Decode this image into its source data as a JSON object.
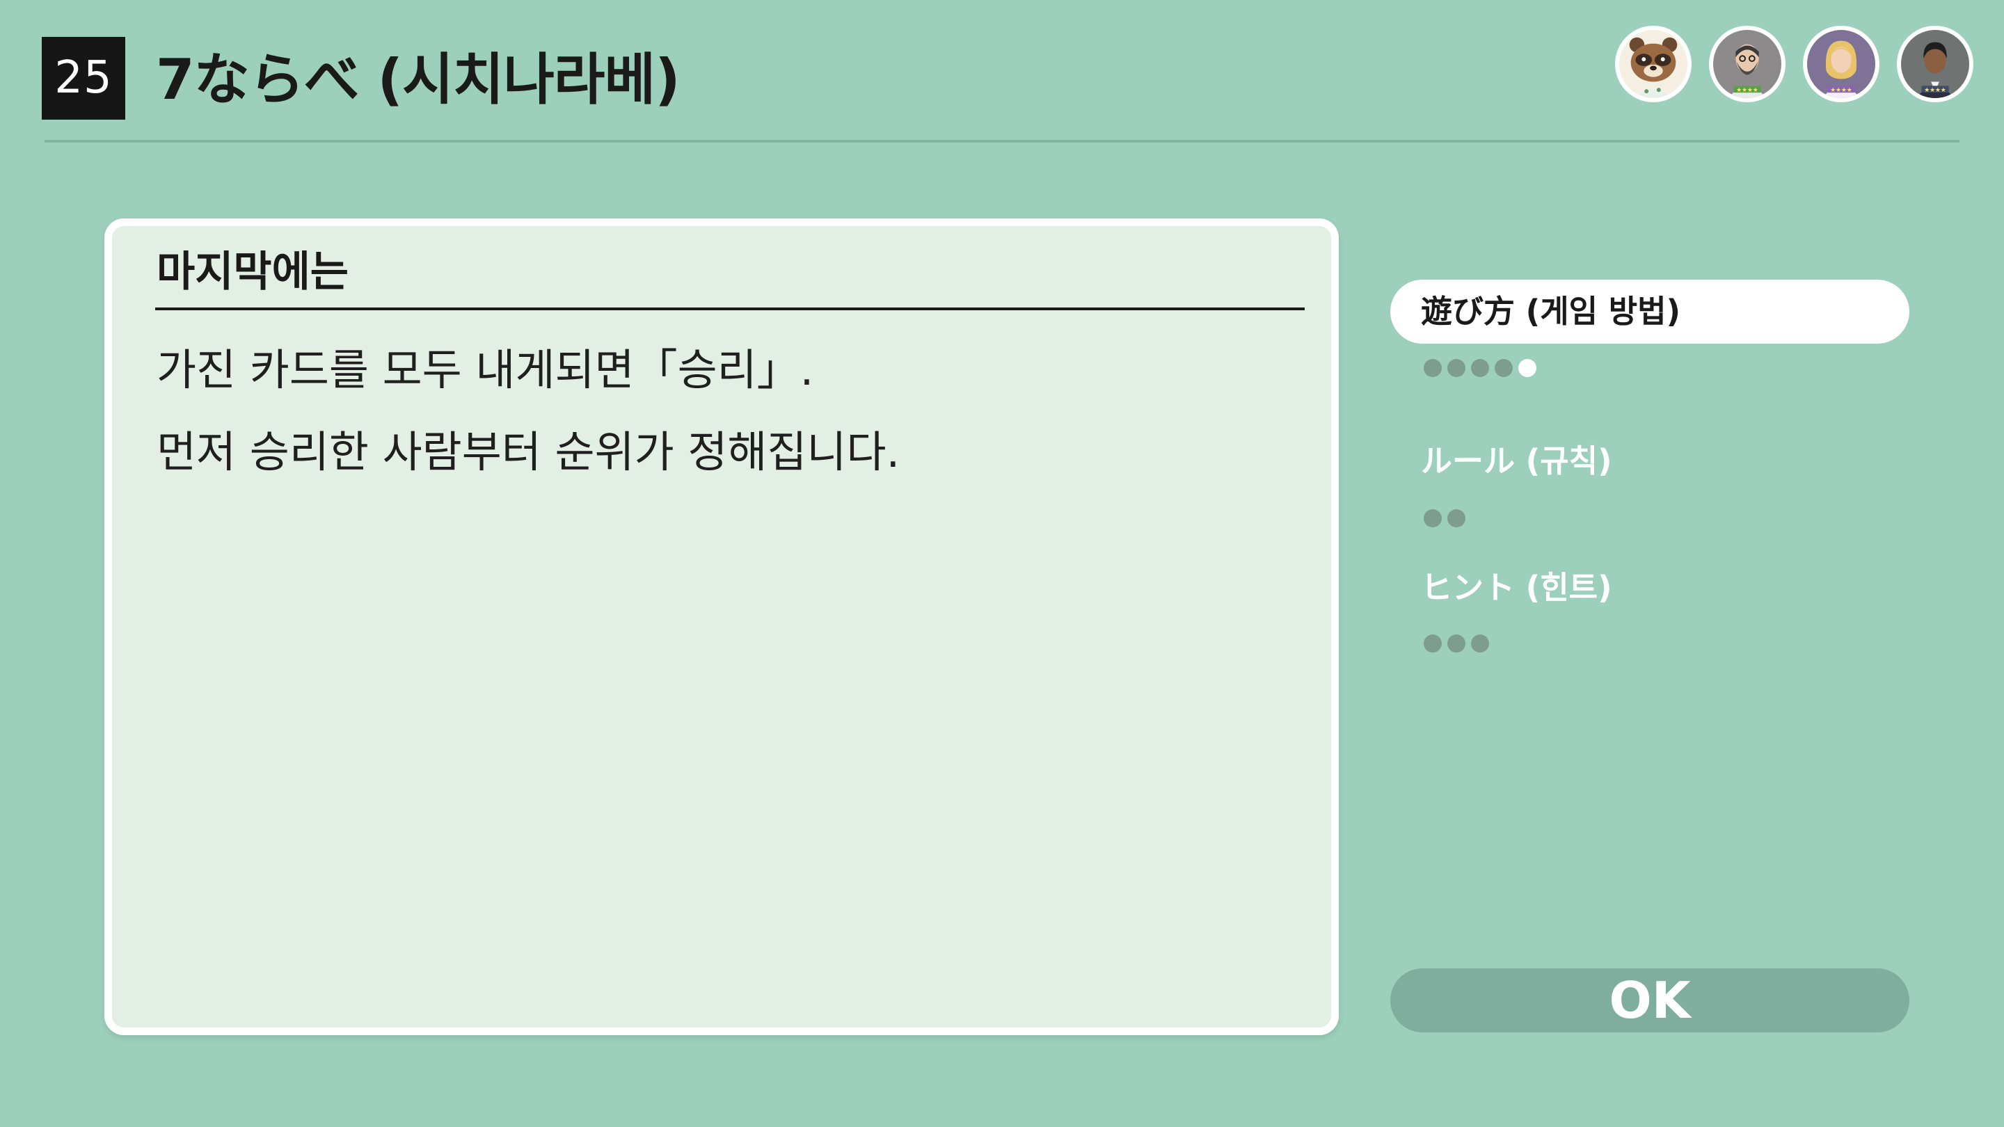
{
  "header": {
    "game_number": "25",
    "title": "7ならべ (시치나라베)"
  },
  "players": [
    {
      "name": "tom-nook-avatar"
    },
    {
      "name": "bearded-man-avatar"
    },
    {
      "name": "blonde-woman-avatar"
    },
    {
      "name": "dark-hair-man-avatar"
    }
  ],
  "card": {
    "heading": "마지막에는",
    "lines": [
      "가진 카드를 모두 내게되면「승리」.",
      "먼저 승리한 사람부터 순위가 정해집니다."
    ]
  },
  "menu": {
    "play": {
      "label": "遊び方 (게임 방법)",
      "pages": 5,
      "current": 5
    },
    "rules": {
      "label": "ルール (규칙)",
      "pages": 2
    },
    "hints": {
      "label": "ヒント (힌트)",
      "pages": 3
    }
  },
  "ok_label": "OK",
  "colors": {
    "background": "#9dcfbd",
    "card": "#e3efe5",
    "ok_button": "#80ae9e",
    "dot_inactive": "#7d9d91",
    "dot_active": "#ffffff"
  }
}
